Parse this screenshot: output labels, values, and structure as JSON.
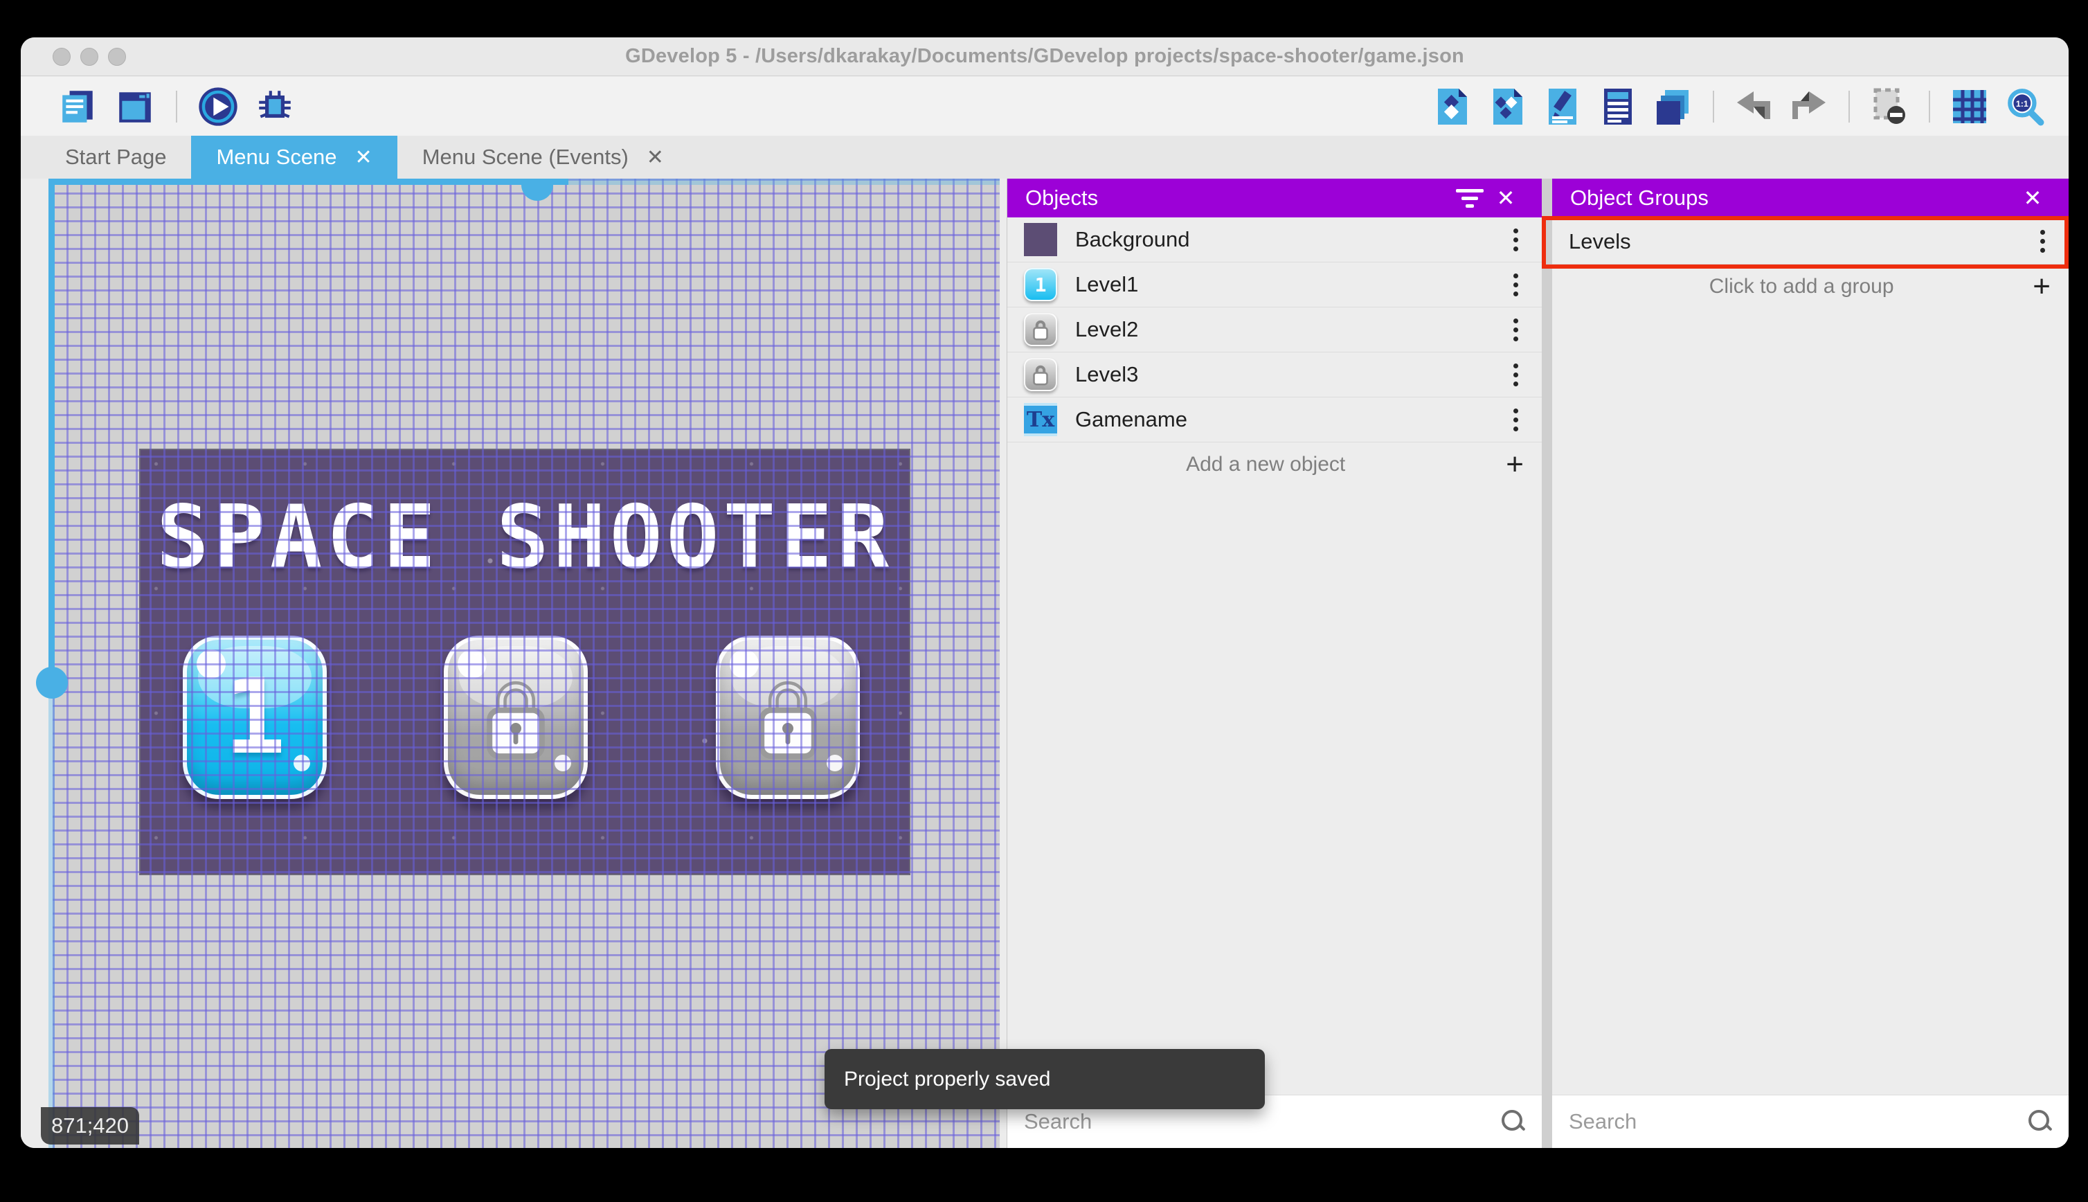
{
  "window": {
    "title": "GDevelop 5 - /Users/dkarakay/Documents/GDevelop projects/space-shooter/game.json"
  },
  "toolbar": {
    "left_icons": [
      "project-manager-icon",
      "scene-editor-icon",
      "play-preview-icon",
      "debug-icon"
    ],
    "right_icons": [
      "objects-editor-icon",
      "object-groups-editor-icon",
      "properties-icon",
      "instances-list-icon",
      "layers-editor-icon",
      "undo-icon",
      "redo-icon",
      "mask-icon",
      "grid-icon",
      "zoom-one-to-one-icon"
    ],
    "zoom_label": "1:1"
  },
  "tabs": [
    {
      "label": "Start Page",
      "active": false,
      "closable": false
    },
    {
      "label": "Menu Scene",
      "active": true,
      "closable": true
    },
    {
      "label": "Menu Scene (Events)",
      "active": false,
      "closable": true
    }
  ],
  "glyphs": {
    "close": "✕",
    "plus": "+",
    "text_object": "Tx"
  },
  "canvas": {
    "coordinates": "871;420",
    "scene_title": "SPACE SHOOTER",
    "scene_buttons": [
      {
        "label": "1",
        "state": "unlocked"
      },
      {
        "label": "",
        "state": "locked"
      },
      {
        "label": "",
        "state": "locked"
      }
    ]
  },
  "objects_panel": {
    "title": "Objects",
    "items": [
      {
        "name": "Background",
        "thumb": "purple-square"
      },
      {
        "name": "Level1",
        "thumb": "blue-button",
        "thumb_label": "1"
      },
      {
        "name": "Level2",
        "thumb": "locked-button"
      },
      {
        "name": "Level3",
        "thumb": "locked-button"
      },
      {
        "name": "Gamename",
        "thumb": "text-object"
      }
    ],
    "add_label": "Add a new object",
    "search_placeholder": "Search"
  },
  "object_groups_panel": {
    "title": "Object Groups",
    "groups": [
      {
        "name": "Levels",
        "highlighted": true
      }
    ],
    "add_label": "Click to add a group",
    "search_placeholder": "Search"
  },
  "toast": {
    "message": "Project properly saved"
  },
  "colors": {
    "accent_blue": "#4ab0e4",
    "panel_header_purple": "#9c01d7",
    "highlight_red": "#ee2d0e",
    "scene_purple": "#5c4d74",
    "toolbar_navy": "#2b3990",
    "canvas_grid_line": "#685fdc",
    "toast_bg": "#3a3a3a"
  }
}
